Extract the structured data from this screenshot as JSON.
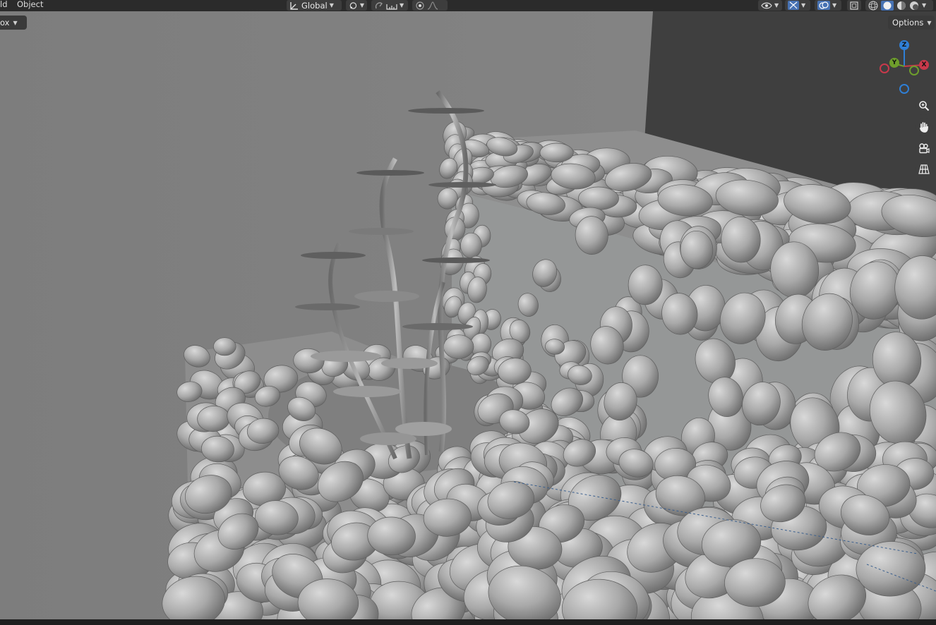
{
  "topbar": {
    "menu_add_fragment": "ld",
    "menu_object": "Object",
    "transform_orientation": "Global"
  },
  "viewport_header": {
    "left_dropdown_fragment": "ox",
    "options_label": "Options"
  },
  "gizmo": {
    "z_label": "Z",
    "y_label": "Y",
    "x_label": "X"
  },
  "colors": {
    "x_axis": "#c9394b",
    "y_axis": "#6e9e2c",
    "z_axis": "#2f7fd6",
    "header_bg": "#2b2b2b",
    "viewport_floor": "#7b7b7b"
  },
  "icons": [
    "transform-orientation-icon",
    "pivot-icon",
    "snap-icon",
    "snap-increment-icon",
    "proportional-edit-icon",
    "falloff-icon",
    "visibility-icon",
    "gizmo-toggle-icon",
    "overlay-icon",
    "xray-icon",
    "shading-wireframe-icon",
    "shading-solid-icon",
    "shading-material-icon",
    "shading-rendered-icon",
    "zoom-icon",
    "hand-icon",
    "camera-icon",
    "grid-icon"
  ]
}
